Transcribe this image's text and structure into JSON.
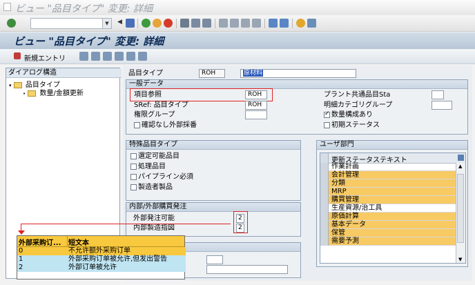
{
  "window": {
    "title": "ビュー \"品目タイプ\" 変更: 詳細"
  },
  "screen": {
    "title": "ビュー \"品目タイプ\" 変更: 詳細"
  },
  "toolbar": {
    "new_entries": "新規エントリ"
  },
  "dialog_structure": {
    "title": "ダイアログ構造",
    "items": [
      {
        "label": "品目タイプ",
        "selected": true
      },
      {
        "label": "数量/金額更新",
        "selected": false
      }
    ]
  },
  "material_type": {
    "label": "品目タイプ",
    "code": "ROH",
    "description": "原材料"
  },
  "general_data": {
    "title": "一般データ",
    "ref_material_type": {
      "label": "項目参照",
      "value": "ROH"
    },
    "sref_material_type": {
      "label": "SRef: 品目タイプ",
      "value": "ROH"
    },
    "auth_group": {
      "label": "権限グループ",
      "value": ""
    },
    "no_confirm_ext_purchase": {
      "label": "確認なし外部採番",
      "checked": false
    },
    "plant_common_status": {
      "label": "プラント共通品目Sta",
      "value": ""
    },
    "detail_category_group": {
      "label": "明細カテゴリグループ",
      "value": ""
    },
    "qty_structure": {
      "label": "数量構成あり",
      "checked": true
    },
    "initial_status": {
      "label": "初期ステータス",
      "checked": false
    }
  },
  "special_material": {
    "title": "特殊品目タイプ",
    "options": [
      {
        "label": "選定可能品目",
        "checked": false
      },
      {
        "label": "処理品目",
        "checked": false
      },
      {
        "label": "パイプライン必須",
        "checked": false
      },
      {
        "label": "製造者製品",
        "checked": false
      }
    ]
  },
  "purchase": {
    "title": "内部/外部購買発注",
    "external": {
      "label": "外部発注可能",
      "value": "2"
    },
    "internal": {
      "label": "内部製造指図",
      "value": "2"
    }
  },
  "user_dept": {
    "title": "ユーザ部門",
    "header": "更新ステータステキスト",
    "rows": [
      {
        "label": "作業計画",
        "highlight": false
      },
      {
        "label": "会計管理",
        "highlight": true
      },
      {
        "label": "分類",
        "highlight": true
      },
      {
        "label": "MRP",
        "highlight": true
      },
      {
        "label": "購買管理",
        "highlight": true
      },
      {
        "label": "生産資源/治工具",
        "highlight": false
      },
      {
        "label": "原価計算",
        "highlight": true
      },
      {
        "label": "基本データ",
        "highlight": true
      },
      {
        "label": "保管",
        "highlight": true
      },
      {
        "label": "需要予測",
        "highlight": true
      }
    ]
  },
  "popup": {
    "col1": "外部采购订...",
    "col2": "短文本",
    "rows": [
      {
        "key": "0",
        "text": "不允许额外采购订单",
        "selected": true
      },
      {
        "key": "1",
        "text": "外部采购订单被允许,但发出警告",
        "selected": false
      },
      {
        "key": "2",
        "text": "外部订单被允许",
        "selected": false
      }
    ]
  }
}
